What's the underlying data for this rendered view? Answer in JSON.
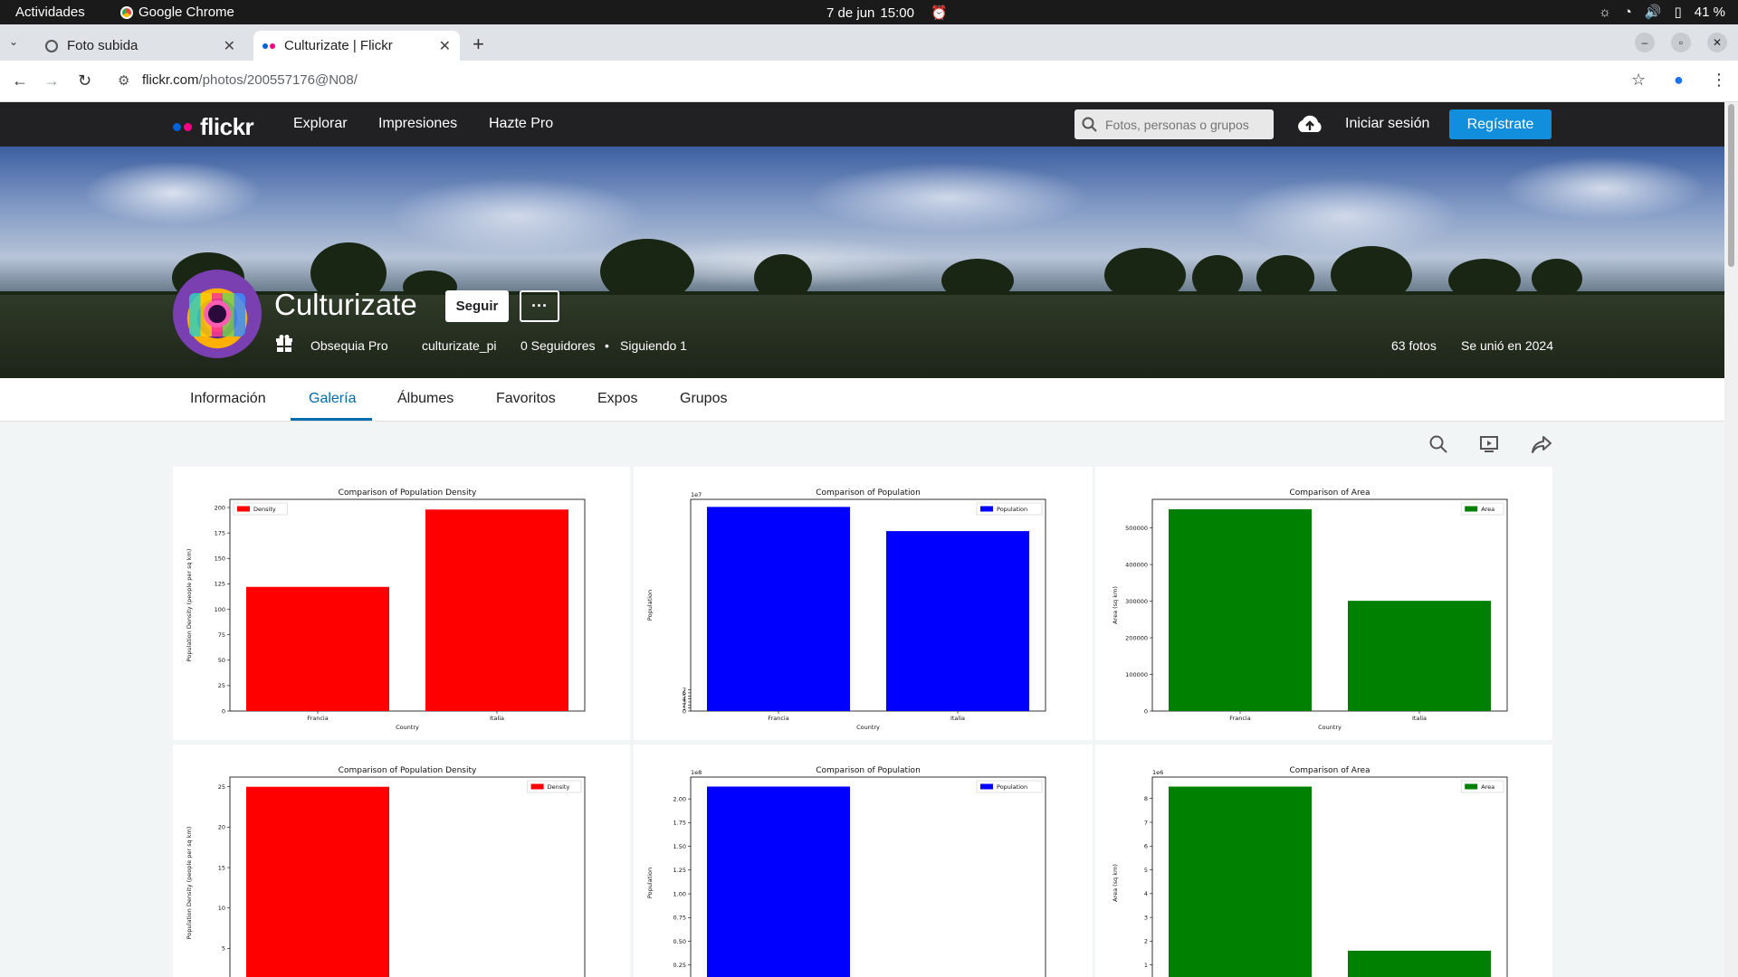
{
  "system": {
    "activities": "Actividades",
    "app_name": "Google Chrome",
    "date": "7 de jun",
    "time": "15:00",
    "battery": "41 %"
  },
  "browser": {
    "tabs": [
      {
        "title": "Foto subida",
        "active": false
      },
      {
        "title": "Culturizate | Flickr",
        "active": true
      }
    ],
    "url_host": "flickr.com",
    "url_path": "/photos/200557176@N08/"
  },
  "flickr_nav": {
    "logo": "flickr",
    "links": [
      "Explorar",
      "Impresiones",
      "Hazte Pro"
    ],
    "search_placeholder": "Fotos, personas o grupos",
    "login": "Iniciar sesión",
    "register": "Regístrate",
    "colors": {
      "blue_dot": "#0063dc",
      "pink_dot": "#ff0084",
      "register_bg": "#128fdc"
    }
  },
  "profile": {
    "name": "Culturizate",
    "follow": "Seguir",
    "more": "···",
    "gift_pro": "Obsequia Pro",
    "handle": "culturizate_pi",
    "followers": "0 Seguidores",
    "separator": "•",
    "following": "Siguiendo 1",
    "photos": "63 fotos",
    "joined": "Se unió en 2024"
  },
  "subnav": {
    "tabs": [
      "Información",
      "Galería",
      "Álbumes",
      "Favoritos",
      "Expos",
      "Grupos"
    ],
    "active": "Galería"
  },
  "chart_data": [
    {
      "type": "bar",
      "title": "Comparison of Population Density",
      "categories": [
        "Francia",
        "Italia"
      ],
      "series": [
        {
          "name": "Density",
          "values": [
            122,
            198
          ]
        }
      ],
      "xlabel": "Country",
      "ylabel": "Population Density (people per sq km)",
      "ylim": [
        0,
        208
      ],
      "yticks": [
        "0",
        "25",
        "50",
        "75",
        "100",
        "125",
        "150",
        "175",
        "200"
      ],
      "scale_label": "",
      "color": "#ff0000",
      "legend": "top-left"
    },
    {
      "type": "bar",
      "title": "Comparison of Population",
      "categories": [
        "Francia",
        "Italia"
      ],
      "series": [
        {
          "name": "Population",
          "values": [
            67.5,
            59.5
          ]
        }
      ],
      "xlabel": "Country",
      "ylabel": "Population",
      "ylim": [
        0,
        70
      ],
      "yticks": [
        "0",
        "1",
        "2",
        "3",
        "4",
        "5",
        "6",
        "7"
      ],
      "scale_label": "1e7",
      "color": "#0000ff",
      "legend": "top-right"
    },
    {
      "type": "bar",
      "title": "Comparison of Area",
      "categories": [
        "Francia",
        "Italia"
      ],
      "series": [
        {
          "name": "Area",
          "values": [
            551000,
            301000
          ]
        }
      ],
      "xlabel": "Country",
      "ylabel": "Area (sq km)",
      "ylim": [
        0,
        578000
      ],
      "yticks": [
        "0",
        "100000",
        "200000",
        "300000",
        "400000",
        "500000"
      ],
      "scale_label": "",
      "color": "#008000",
      "legend": "top-right"
    },
    {
      "type": "bar",
      "title": "Comparison of Population Density",
      "categories": [
        "",
        ""
      ],
      "series": [
        {
          "name": "Density",
          "values": [
            25,
            0.6
          ]
        }
      ],
      "xlabel": "",
      "ylabel": "Population Density (people per sq km)",
      "ylim": [
        0,
        26.2
      ],
      "yticks": [
        "0",
        "5",
        "10",
        "15",
        "20",
        "25"
      ],
      "scale_label": "",
      "color": "#ff0000",
      "legend": "top-right"
    },
    {
      "type": "bar",
      "title": "Comparison of Population",
      "categories": [
        "",
        ""
      ],
      "series": [
        {
          "name": "Population",
          "values": [
            2.13,
            0
          ]
        }
      ],
      "xlabel": "",
      "ylabel": "Population",
      "ylim": [
        0,
        2.23
      ],
      "yticks": [
        "0",
        "0.25",
        "0.50",
        "0.75",
        "1.00",
        "1.25",
        "1.50",
        "1.75",
        "2.00"
      ],
      "scale_label": "1e8",
      "color": "#0000ff",
      "legend": "top-right"
    },
    {
      "type": "bar",
      "title": "Comparison of Area",
      "categories": [
        "",
        ""
      ],
      "series": [
        {
          "name": "Area",
          "values": [
            8.5,
            1.6
          ]
        }
      ],
      "xlabel": "",
      "ylabel": "Area (sq km)",
      "ylim": [
        0,
        8.9
      ],
      "yticks": [
        "0",
        "1",
        "2",
        "3",
        "4",
        "5",
        "6",
        "7",
        "8"
      ],
      "scale_label": "1e6",
      "color": "#008000",
      "legend": "top-right"
    }
  ]
}
